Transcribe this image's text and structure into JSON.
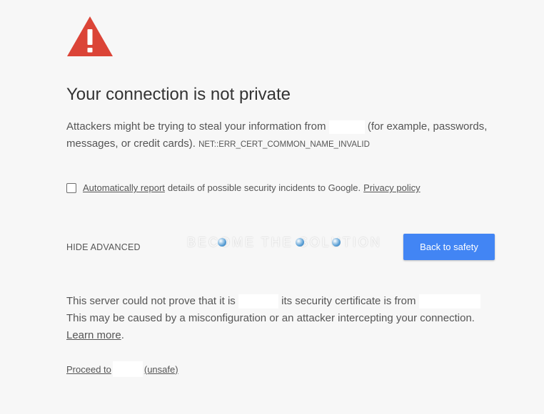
{
  "heading": "Your connection is not private",
  "description": {
    "before_host": "Attackers might be trying to steal your information from",
    "after_host": "(for example, passwords, messages, or credit cards).",
    "error_code": "NET::ERR_CERT_COMMON_NAME_INVALID"
  },
  "report": {
    "link_label": "Automatically report",
    "text": "details of possible security incidents to Google.",
    "privacy_link": "Privacy policy"
  },
  "advanced_toggle": "HIDE ADVANCED",
  "watermark": "BECOME THE SOLUTION",
  "back_button": "Back to safety",
  "details": {
    "part1": "This server could not prove that it is",
    "part2": "its security certificate is from",
    "line2": "This may be caused by a misconfiguration or an attacker intercepting your connection.",
    "learn_more": "Learn more"
  },
  "proceed": {
    "prefix": "Proceed to",
    "suffix": "(unsafe)"
  },
  "colors": {
    "warning_red": "#db4437",
    "button_blue": "#4285f4",
    "background": "#f7f7f7"
  },
  "icons": {
    "warning": "warning-triangle-icon",
    "checkbox": "checkbox-unchecked"
  }
}
